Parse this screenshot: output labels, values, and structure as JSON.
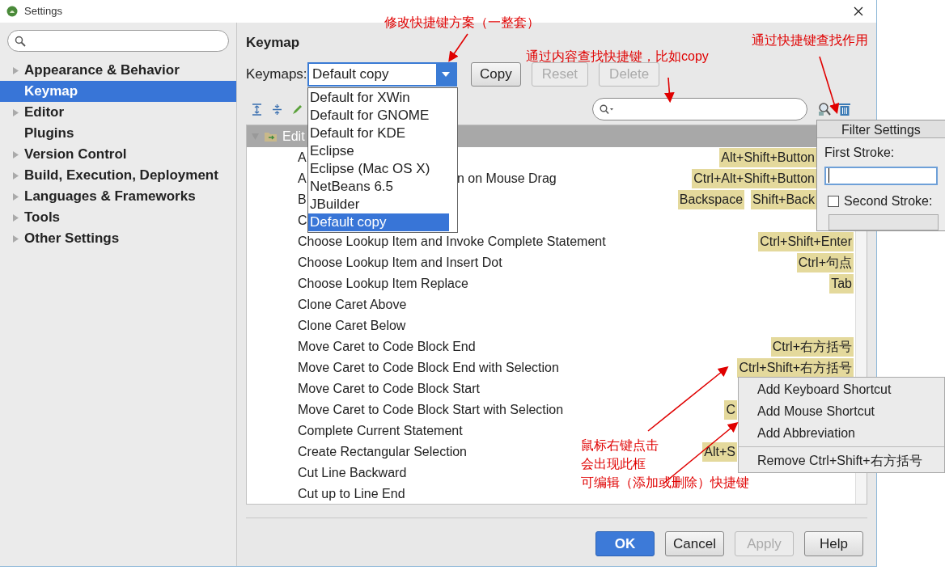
{
  "window": {
    "title": "Settings"
  },
  "sidebar": {
    "items": [
      {
        "label": "Appearance & Behavior",
        "expandable": true,
        "selected": false
      },
      {
        "label": "Keymap",
        "expandable": false,
        "selected": true
      },
      {
        "label": "Editor",
        "expandable": true,
        "selected": false
      },
      {
        "label": "Plugins",
        "expandable": false,
        "selected": false
      },
      {
        "label": "Version Control",
        "expandable": true,
        "selected": false
      },
      {
        "label": "Build, Execution, Deployment",
        "expandable": true,
        "selected": false
      },
      {
        "label": "Languages & Frameworks",
        "expandable": true,
        "selected": false
      },
      {
        "label": "Tools",
        "expandable": true,
        "selected": false
      },
      {
        "label": "Other Settings",
        "expandable": true,
        "selected": false
      }
    ]
  },
  "keymap": {
    "heading": "Keymap",
    "keymaps_label": "Keymaps:",
    "selected_keymap": "Default copy",
    "buttons": [
      {
        "label": "Copy",
        "disabled": false
      },
      {
        "label": "Reset",
        "disabled": true
      },
      {
        "label": "Delete",
        "disabled": true
      }
    ],
    "dropdown": [
      {
        "label": "Default for XWin",
        "selected": false
      },
      {
        "label": "Default for GNOME",
        "selected": false
      },
      {
        "label": "Default for KDE",
        "selected": false
      },
      {
        "label": "Eclipse",
        "selected": false
      },
      {
        "label": "Eclipse (Mac OS X)",
        "selected": false
      },
      {
        "label": "NetBeans 6.5",
        "selected": false
      },
      {
        "label": "JBuilder",
        "selected": false
      },
      {
        "label": "Default copy",
        "selected": true
      }
    ]
  },
  "tree_header": {
    "label": "Edit",
    "expanded": true
  },
  "actions": [
    {
      "kind": "popup",
      "name": "A",
      "shortcuts": [
        "Alt+Shift+Button"
      ]
    },
    {
      "kind": "popup",
      "name": "A",
      "name_tail": "n on Mouse Drag",
      "shortcuts": [
        "Ctrl+Alt+Shift+Button"
      ]
    },
    {
      "kind": "popup",
      "name": "B",
      "shortcuts": [
        "Backspace",
        "Shift+Back"
      ]
    },
    {
      "kind": "plain",
      "name": "C"
    },
    {
      "kind": "plain",
      "name": "Choose Lookup Item and Invoke Complete Statement",
      "shortcuts": [
        "Ctrl+Shift+Enter"
      ]
    },
    {
      "kind": "plain",
      "name": "Choose Lookup Item and Insert Dot",
      "shortcuts": [
        "Ctrl+句点"
      ]
    },
    {
      "kind": "plain",
      "name": "Choose Lookup Item Replace",
      "shortcuts": [
        "Tab"
      ]
    },
    {
      "kind": "plain",
      "name": "Clone Caret Above"
    },
    {
      "kind": "plain",
      "name": "Clone Caret Below"
    },
    {
      "kind": "plain",
      "name": "Move Caret to Code Block End",
      "shortcuts": [
        "Ctrl+右方括号"
      ]
    },
    {
      "kind": "plain",
      "name": "Move Caret to Code Block End with Selection",
      "shortcuts": [
        "Ctrl+Shift+右方括号"
      ]
    },
    {
      "kind": "plain",
      "name": "Move Caret to Code Block Start"
    },
    {
      "kind": "menu",
      "name": "Move Caret to Code Block Start with Selection",
      "shortcuts": [
        "C"
      ]
    },
    {
      "kind": "plain",
      "name": "Complete Current Statement"
    },
    {
      "kind": "menu",
      "name": "Create Rectangular Selection",
      "shortcuts": [
        "Alt+S"
      ]
    },
    {
      "kind": "plain",
      "name": "Cut Line Backward"
    },
    {
      "kind": "plain",
      "name": "Cut up to Line End"
    }
  ],
  "filter_settings": {
    "title": "Filter Settings",
    "first_stroke_label": "First Stroke:",
    "second_stroke_label": "Second Stroke:",
    "second_stroke_checked": false
  },
  "context_menu": [
    {
      "label": "Add Keyboard Shortcut",
      "separator_before": false
    },
    {
      "label": "Add Mouse Shortcut",
      "separator_before": false
    },
    {
      "label": "Add Abbreviation",
      "separator_before": false
    },
    {
      "label": "Remove Ctrl+Shift+右方括号",
      "separator_before": true
    }
  ],
  "footer_buttons": [
    {
      "label": "OK",
      "kind": "primary",
      "disabled": false
    },
    {
      "label": "Cancel",
      "kind": "normal",
      "disabled": false
    },
    {
      "label": "Apply",
      "kind": "normal",
      "disabled": true
    },
    {
      "label": "Help",
      "kind": "normal",
      "disabled": false
    }
  ],
  "annotations": [
    {
      "lines": [
        "修改快捷键方案（一整套）"
      ]
    },
    {
      "lines": [
        "通过内容查找快捷键，比如copy"
      ]
    },
    {
      "lines": [
        "通过快捷键查找作用"
      ]
    },
    {
      "lines": [
        "鼠标右键点击",
        "会出现此框",
        "可编辑（添加或删除）快捷键"
      ]
    }
  ]
}
